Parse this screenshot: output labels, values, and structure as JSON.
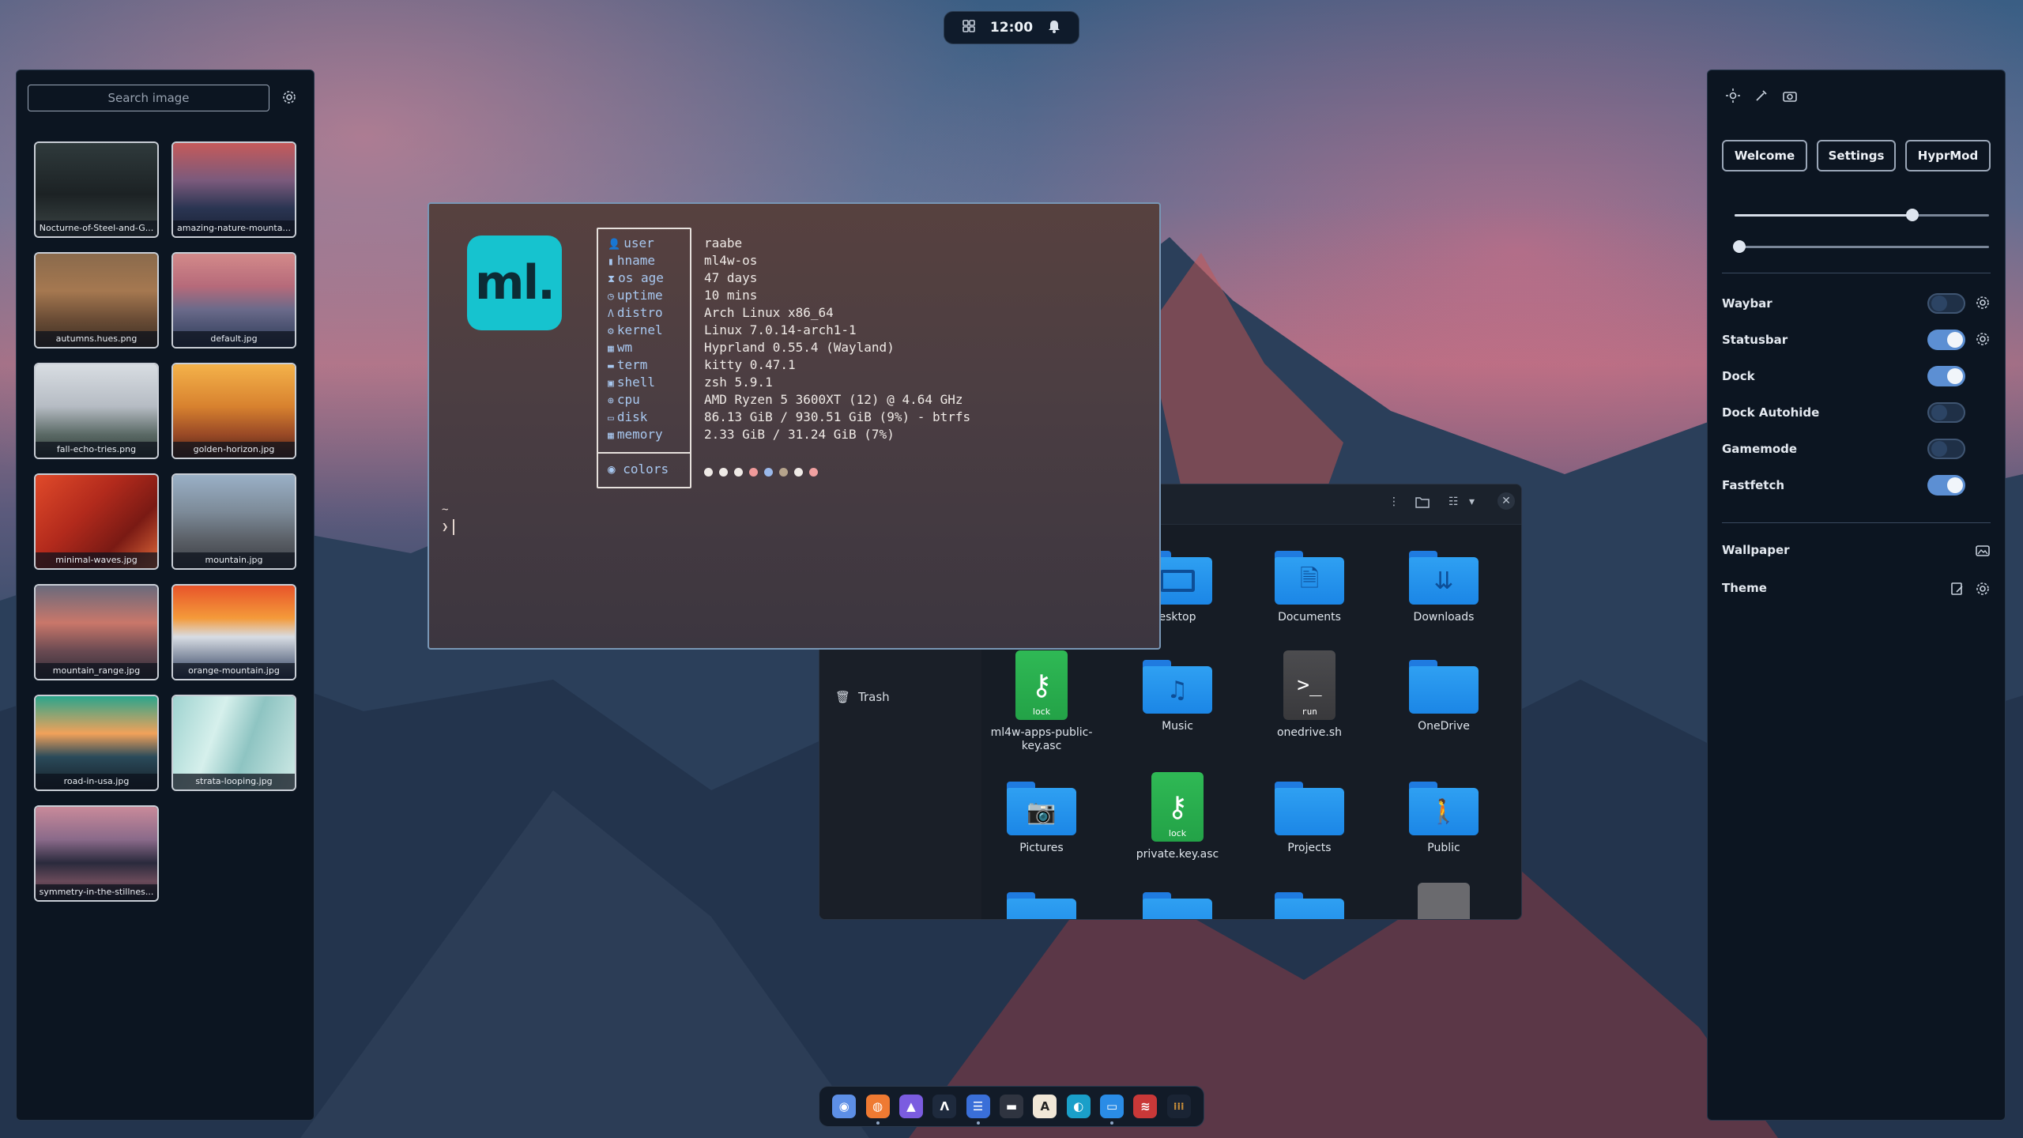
{
  "topbar": {
    "time": "12:00"
  },
  "wallpaper_panel": {
    "search_placeholder": "Search image",
    "images": [
      {
        "name": "Nocturne-of-Steel-and-G..."
      },
      {
        "name": "amazing-nature-mounta..."
      },
      {
        "name": "autumns.hues.png"
      },
      {
        "name": "default.jpg"
      },
      {
        "name": "fall-echo-tries.png"
      },
      {
        "name": "golden-horizon.jpg"
      },
      {
        "name": "minimal-waves.jpg"
      },
      {
        "name": "mountain.jpg"
      },
      {
        "name": "mountain_range.jpg"
      },
      {
        "name": "orange-mountain.jpg"
      },
      {
        "name": "road-in-usa.jpg"
      },
      {
        "name": "strata-looping.jpg"
      },
      {
        "name": "symmetry-in-the-stillnes..."
      }
    ]
  },
  "terminal": {
    "logo": "ml.",
    "fields": [
      {
        "label": "user",
        "value": "raabe"
      },
      {
        "label": "hname",
        "value": "ml4w-os"
      },
      {
        "label": "os age",
        "value": "47 days"
      },
      {
        "label": "uptime",
        "value": "10 mins"
      },
      {
        "label": "distro",
        "value": "Arch Linux x86_64"
      },
      {
        "label": "kernel",
        "value": "Linux 7.0.14-arch1-1"
      },
      {
        "label": "wm",
        "value": "Hyprland 0.55.4 (Wayland)"
      },
      {
        "label": "term",
        "value": "kitty 0.47.1"
      },
      {
        "label": "shell",
        "value": "zsh 5.9.1"
      },
      {
        "label": "cpu",
        "value": "AMD Ryzen 5 3600XT (12) @ 4.64 GHz"
      },
      {
        "label": "disk",
        "value": "86.13 GiB / 930.51 GiB (9%) - btrfs"
      },
      {
        "label": "memory",
        "value": "2.33 GiB / 31.24 GiB (7%)"
      }
    ],
    "colors_label": "colors",
    "palette": [
      "#efeae6",
      "#efeae6",
      "#efeae6",
      "#f09a9a",
      "#9ab8ea",
      "#b6a48c",
      "#efeae6",
      "#f1a1a1"
    ],
    "prompt_line1": "~",
    "prompt_line2": "❯"
  },
  "file_manager": {
    "sidebar_trash": "Trash",
    "items": [
      {
        "label": "esktop",
        "kind": "folder",
        "glyph": ""
      },
      {
        "label": "Documents",
        "kind": "folder",
        "glyph": "🗎"
      },
      {
        "label": "Downloads",
        "kind": "folder",
        "glyph": "⇊"
      },
      {
        "label": "ml4w-apps-public-key.asc",
        "kind": "key",
        "tag": "lock"
      },
      {
        "label": "Music",
        "kind": "folder",
        "glyph": "♫"
      },
      {
        "label": "onedrive.sh",
        "kind": "run",
        "tag": "run"
      },
      {
        "label": "OneDrive",
        "kind": "folder",
        "glyph": ""
      },
      {
        "label": "Pictures",
        "kind": "folder",
        "glyph": "📷"
      },
      {
        "label": "private.key.asc",
        "kind": "key",
        "tag": "lock"
      },
      {
        "label": "Projects",
        "kind": "folder",
        "glyph": ""
      },
      {
        "label": "Public",
        "kind": "folder",
        "glyph": "🚶"
      }
    ]
  },
  "dock": {
    "apps": [
      {
        "name": "chromium",
        "color": "#5d8fe6",
        "glyph": "◉"
      },
      {
        "name": "firefox",
        "color": "#ef7a32",
        "glyph": "◍"
      },
      {
        "name": "proton-vpn",
        "color": "#7b5ce0",
        "glyph": "▲"
      },
      {
        "name": "arch-text",
        "color": "#1e2a3d",
        "glyph": "Λ"
      },
      {
        "name": "notes",
        "color": "#3a6fd8",
        "glyph": "☰"
      },
      {
        "name": "terminal",
        "color": "#2f3440",
        "glyph": "▬"
      },
      {
        "name": "font-viewer",
        "color": "#f1e7d7",
        "glyph": "A"
      },
      {
        "name": "edge",
        "color": "#1a9fc9",
        "glyph": "◐"
      },
      {
        "name": "files",
        "color": "#2a8ce6",
        "glyph": "▭"
      },
      {
        "name": "pdf-reader",
        "color": "#c93838",
        "glyph": "≋"
      },
      {
        "name": "app-grid",
        "color": "#1a2434",
        "glyph": "⁞⁞⁞"
      }
    ]
  },
  "settings_panel": {
    "buttons": {
      "welcome": "Welcome",
      "settings": "Settings",
      "hyprmod": "HyprMod"
    },
    "sliders": [
      0.7,
      0.02
    ],
    "toggles": [
      {
        "label": "Waybar",
        "on": false,
        "gear": true
      },
      {
        "label": "Statusbar",
        "on": true,
        "gear": true
      },
      {
        "label": "Dock",
        "on": true,
        "gear": false
      },
      {
        "label": "Dock Autohide",
        "on": false,
        "gear": false
      },
      {
        "label": "Gamemode",
        "on": false,
        "gear": false
      },
      {
        "label": "Fastfetch",
        "on": true,
        "gear": false
      }
    ],
    "wallpaper_label": "Wallpaper",
    "theme_label": "Theme"
  }
}
